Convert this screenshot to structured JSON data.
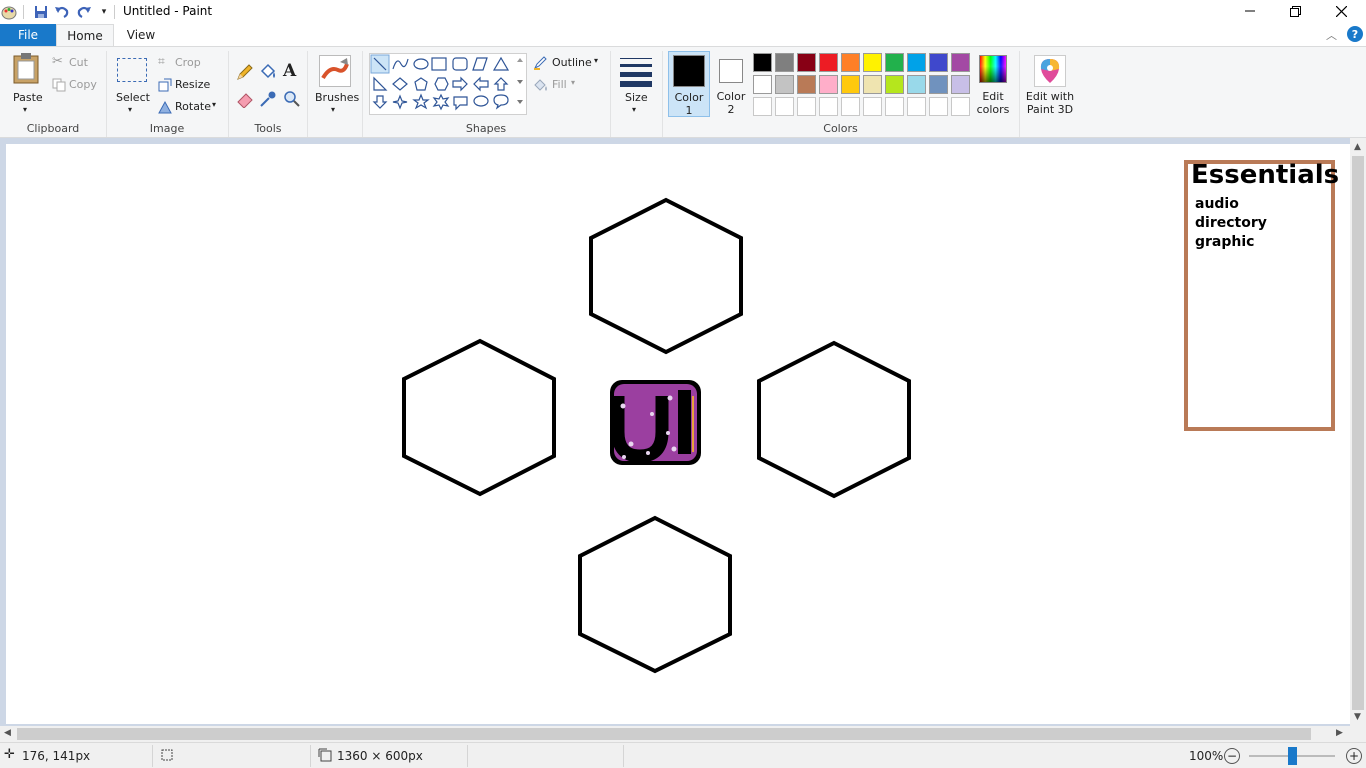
{
  "window": {
    "title": "Untitled - Paint"
  },
  "tabs": {
    "file": "File",
    "home": "Home",
    "view": "View"
  },
  "clipboard": {
    "paste": "Paste",
    "cut": "Cut",
    "copy": "Copy",
    "label": "Clipboard"
  },
  "image": {
    "select": "Select",
    "crop": "Crop",
    "resize": "Resize",
    "rotate": "Rotate",
    "label": "Image"
  },
  "tools": {
    "label": "Tools"
  },
  "brushes": {
    "label": "Brushes"
  },
  "shapes": {
    "outline": "Outline",
    "fill": "Fill",
    "label": "Shapes"
  },
  "size": {
    "label": "Size"
  },
  "colors": {
    "color1": "Color 1",
    "color2": "Color 2",
    "edit": "Edit colors",
    "paint3d": "Edit with Paint 3D",
    "label": "Colors",
    "color1_value": "#000000",
    "color2_value": "#ffffff",
    "palette_row1": [
      "#000000",
      "#7f7f7f",
      "#880015",
      "#ed1c24",
      "#ff7f27",
      "#fff200",
      "#22b14c",
      "#00a2e8",
      "#3f48cc",
      "#a349a4"
    ],
    "palette_row2": [
      "#ffffff",
      "#c3c3c3",
      "#b97a57",
      "#ffaec9",
      "#ffc90e",
      "#efe4b0",
      "#b5e61d",
      "#99d9ea",
      "#7092be",
      "#c8bfe7"
    ],
    "palette_row3": [
      "#ffffff",
      "#ffffff",
      "#ffffff",
      "#ffffff",
      "#ffffff",
      "#ffffff",
      "#ffffff",
      "#ffffff",
      "#ffffff",
      "#ffffff"
    ]
  },
  "canvas": {
    "essentials_title": "Essentials",
    "essentials_items": [
      "audio",
      "directory",
      "graphic"
    ],
    "logo_text": "UI"
  },
  "status": {
    "cursor_pos": "176, 141px",
    "image_size": "1360 × 600px",
    "zoom": "100%"
  }
}
